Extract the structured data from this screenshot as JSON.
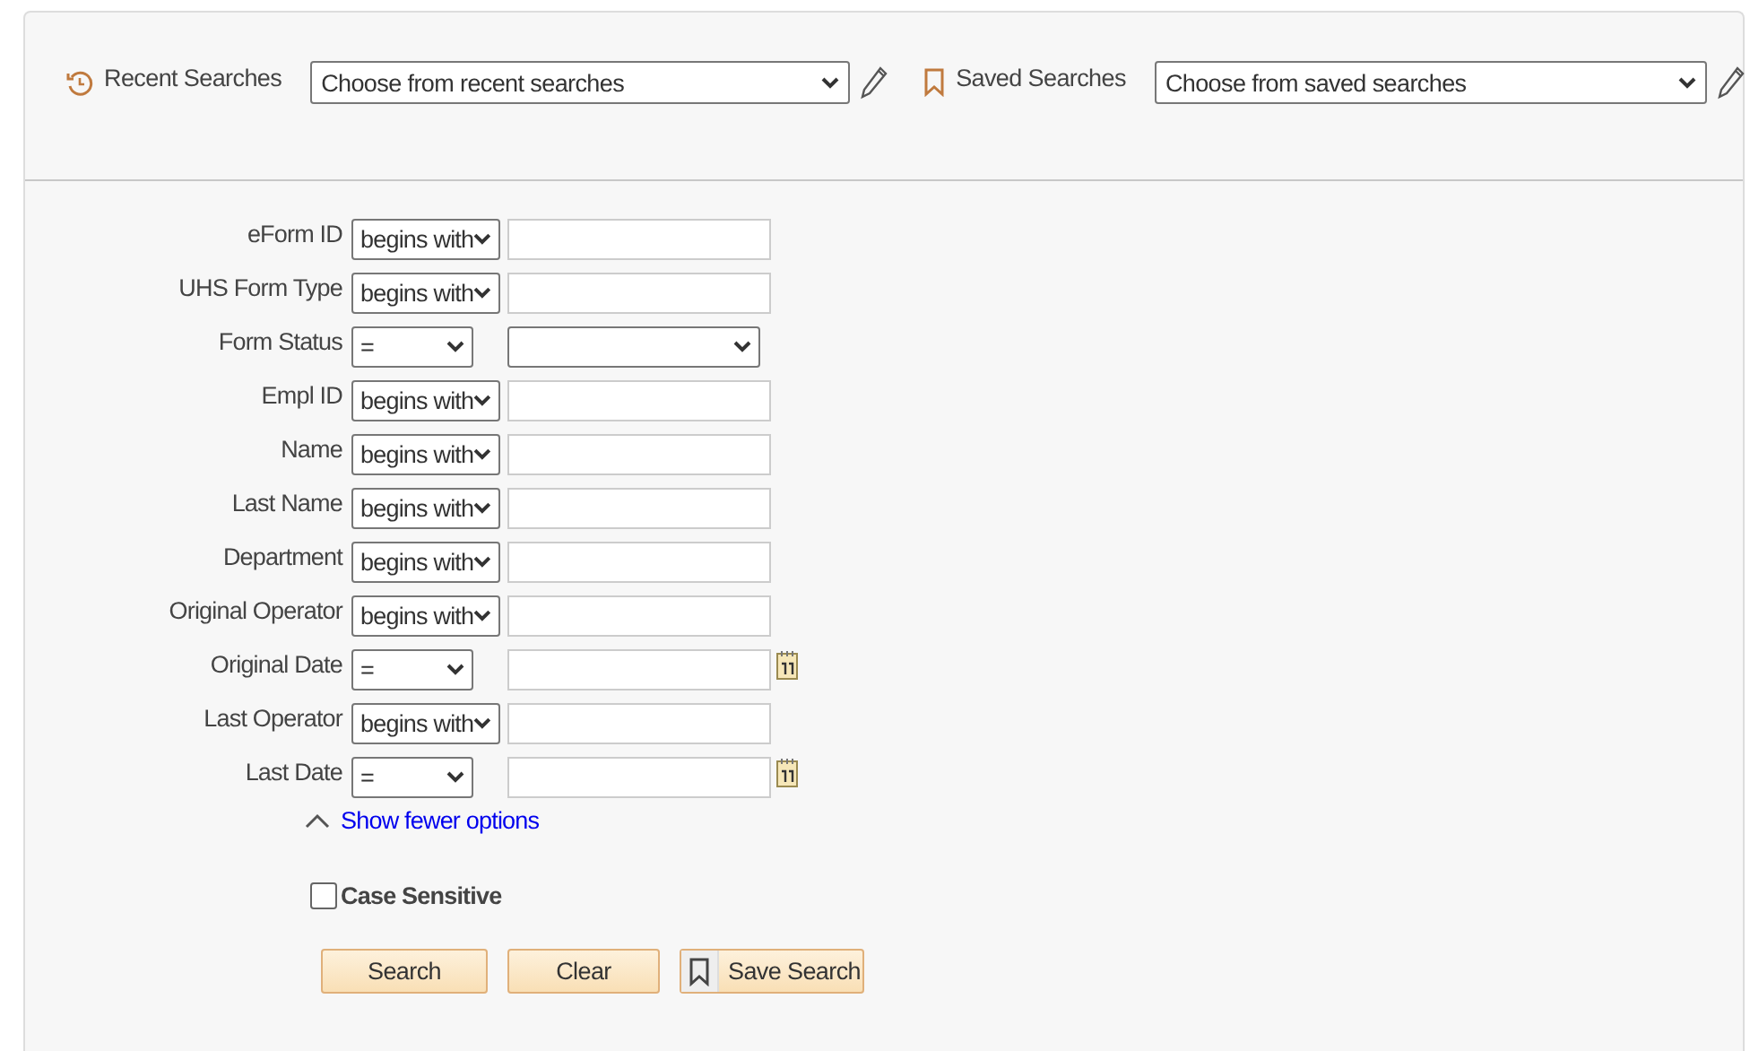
{
  "header": {
    "recent": {
      "label": "Recent Searches",
      "value": "Choose from recent searches"
    },
    "saved": {
      "label": "Saved Searches",
      "value": "Choose from saved searches"
    }
  },
  "criteria": [
    {
      "label": "eForm ID",
      "operator": "begins with",
      "kind": "text"
    },
    {
      "label": "UHS Form Type",
      "operator": "begins with",
      "kind": "text"
    },
    {
      "label": "Form Status",
      "operator": "=",
      "kind": "select"
    },
    {
      "label": "Empl ID",
      "operator": "begins with",
      "kind": "text"
    },
    {
      "label": "Name",
      "operator": "begins with",
      "kind": "text"
    },
    {
      "label": "Last Name",
      "operator": "begins with",
      "kind": "text"
    },
    {
      "label": "Department",
      "operator": "begins with",
      "kind": "text"
    },
    {
      "label": "Original Operator",
      "operator": "begins with",
      "kind": "text"
    },
    {
      "label": "Original Date",
      "operator": "=",
      "kind": "date"
    },
    {
      "label": "Last Operator",
      "operator": "begins with",
      "kind": "text"
    },
    {
      "label": "Last Date",
      "operator": "=",
      "kind": "date"
    }
  ],
  "toggle_link": "Show fewer options",
  "case_sensitive": {
    "label": "Case Sensitive",
    "checked": false
  },
  "buttons": [
    {
      "label": "Search",
      "kind": "plain"
    },
    {
      "label": "Clear",
      "kind": "plain"
    },
    {
      "label": "Save Search",
      "kind": "bookmark"
    }
  ]
}
